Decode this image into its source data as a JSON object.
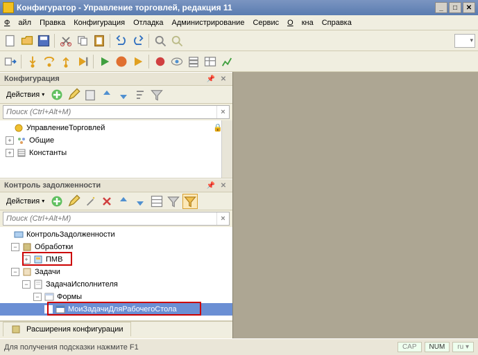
{
  "title": "Конфигуратор - Управление торговлей, редакция 11",
  "menu": {
    "file": "Файл",
    "edit": "Правка",
    "config": "Конфигурация",
    "debug": "Отладка",
    "admin": "Администрирование",
    "service": "Сервис",
    "windows": "Окна",
    "help": "Справка"
  },
  "panel_config": {
    "title": "Конфигурация",
    "actions": "Действия",
    "search_placeholder": "Поиск (Ctrl+Alt+M)",
    "tree": {
      "root": "УправлениеТорговлей",
      "common": "Общие",
      "constants": "Константы"
    }
  },
  "panel_debt": {
    "title": "Контроль задолженности",
    "actions": "Действия",
    "search_placeholder": "Поиск (Ctrl+Alt+M)",
    "tree": {
      "root": "КонтрольЗадолженности",
      "processing": "Обработки",
      "pmv": "ПМВ",
      "tasks": "Задачи",
      "executor_task": "ЗадачаИсполнителя",
      "forms": "Формы",
      "my_tasks": "МоиЗадачиДляРабочегоСтола"
    }
  },
  "footer_tab": "Расширения конфигурации",
  "status": {
    "hint": "Для получения подсказки нажмите F1",
    "cap": "CAP",
    "num": "NUM",
    "lang": "ru"
  }
}
